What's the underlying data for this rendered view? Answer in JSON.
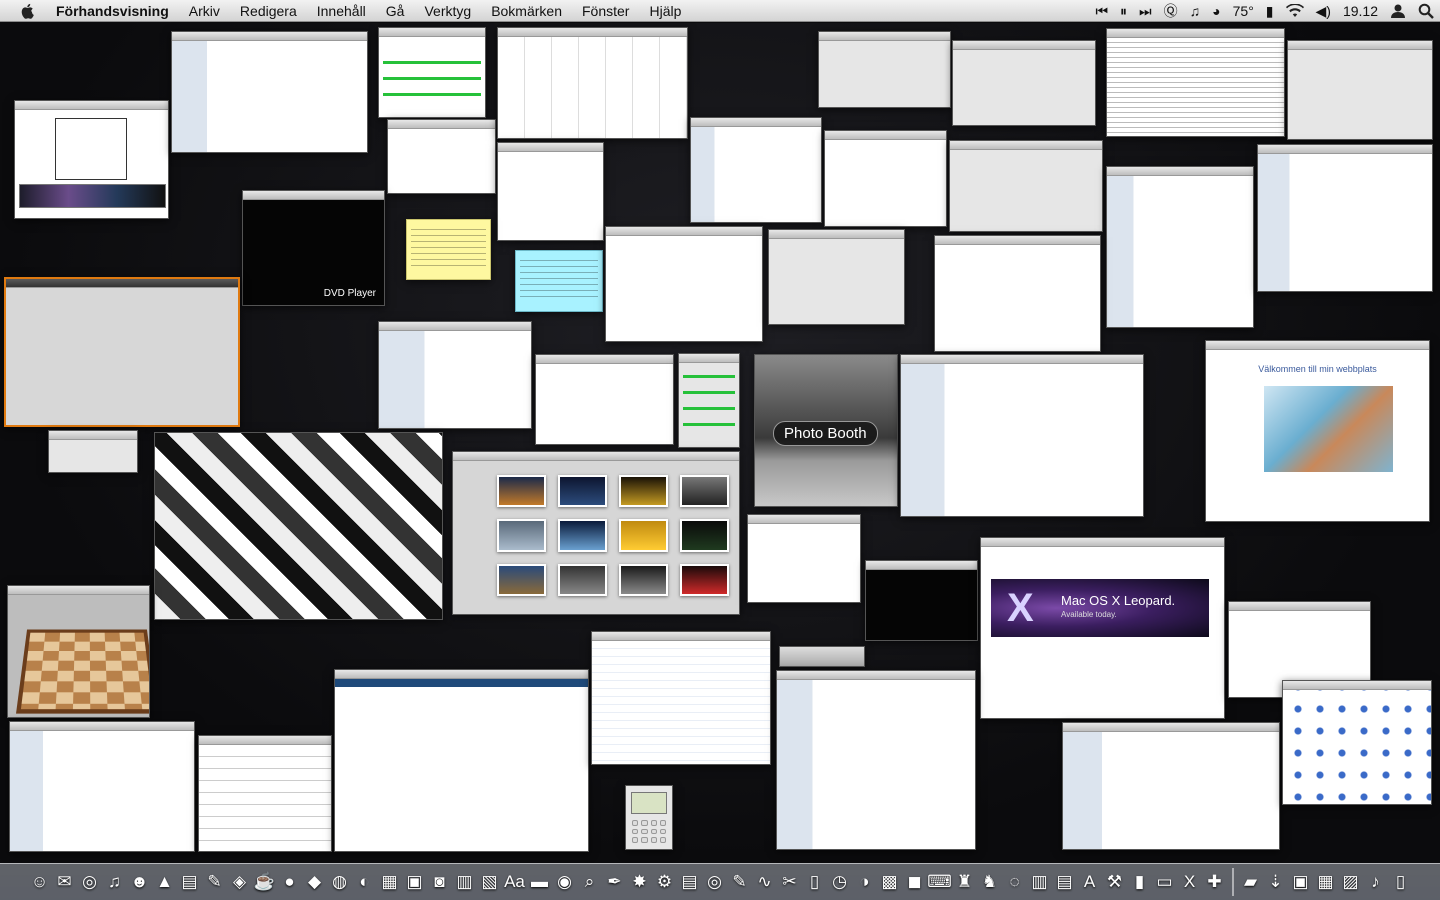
{
  "menubar": {
    "apple_icon": "apple-icon",
    "app_name": "Förhandsvisning",
    "menus": [
      "Arkiv",
      "Redigera",
      "Innehåll",
      "Gå",
      "Verktyg",
      "Bokmärken",
      "Fönster",
      "Hjälp"
    ],
    "temperature": "75°",
    "clock": "19.12"
  },
  "windows": {
    "photo_booth_label": "Photo Booth",
    "dvd_player_label": "DVD Player",
    "welcome_title": "Välkommen till min webbplats",
    "leopard_title": "Mac OS X Leopard.",
    "leopard_subtitle": "Available today."
  },
  "colors": {
    "desktop": "#0b0b0d",
    "selection_orange": "#e07a10",
    "note_yellow": "#fef8a0",
    "note_blue": "#a8f2ff",
    "progress_green": "#26c13a"
  },
  "dock": {
    "items": [
      "finder-icon",
      "mail-icon",
      "safari-icon",
      "itunes-icon",
      "ichat-icon",
      "vlc-icon",
      "address-book-icon",
      "utility-icon",
      "preview-icon",
      "coffee-icon",
      "orb-icon",
      "duck-icon",
      "globe-icon",
      "firefox-icon",
      "ical-icon",
      "iphoto-icon",
      "camera-icon",
      "calculator-icon",
      "stickies-icon",
      "dictionary-icon",
      "book-icon",
      "quicktime-icon",
      "search-icon",
      "pen-icon",
      "star-icon",
      "system-prefs-icon",
      "text-icon",
      "dvd-icon",
      "script-icon",
      "activity-icon",
      "tools-icon",
      "ruler-icon",
      "clock-icon",
      "color-icon",
      "cube-icon",
      "disk-icon",
      "keyboard-icon",
      "chess-icon",
      "photo-booth-icon",
      "network-icon",
      "database-icon",
      "printer-icon",
      "fonts-icon",
      "xcode-icon",
      "terminal-icon",
      "console-icon",
      "x11-icon",
      "grab-icon",
      "folder-icon",
      "downloads-icon",
      "apps-icon",
      "docs-icon",
      "pictures-icon",
      "music-icon",
      "trash-icon"
    ],
    "glyphs": [
      "☺",
      "✉",
      "◎",
      "♫",
      "☻",
      "▲",
      "▤",
      "✎",
      "◈",
      "☕",
      "●",
      "◆",
      "◍",
      "◐",
      "▦",
      "▣",
      "◙",
      "▥",
      "▧",
      "Aa",
      "▬",
      "◉",
      "⌕",
      "✒",
      "✸",
      "⚙",
      "▤",
      "◎",
      "✎",
      "∿",
      "✂",
      "▯",
      "◷",
      "◑",
      "▩",
      "◼",
      "⌨",
      "♜",
      "♞",
      "◌",
      "▥",
      "▤",
      "A",
      "⚒",
      "▮",
      "▭",
      "X",
      "✚",
      "▰",
      "⇣",
      "▣",
      "▦",
      "▨",
      "♪",
      "▯"
    ]
  }
}
